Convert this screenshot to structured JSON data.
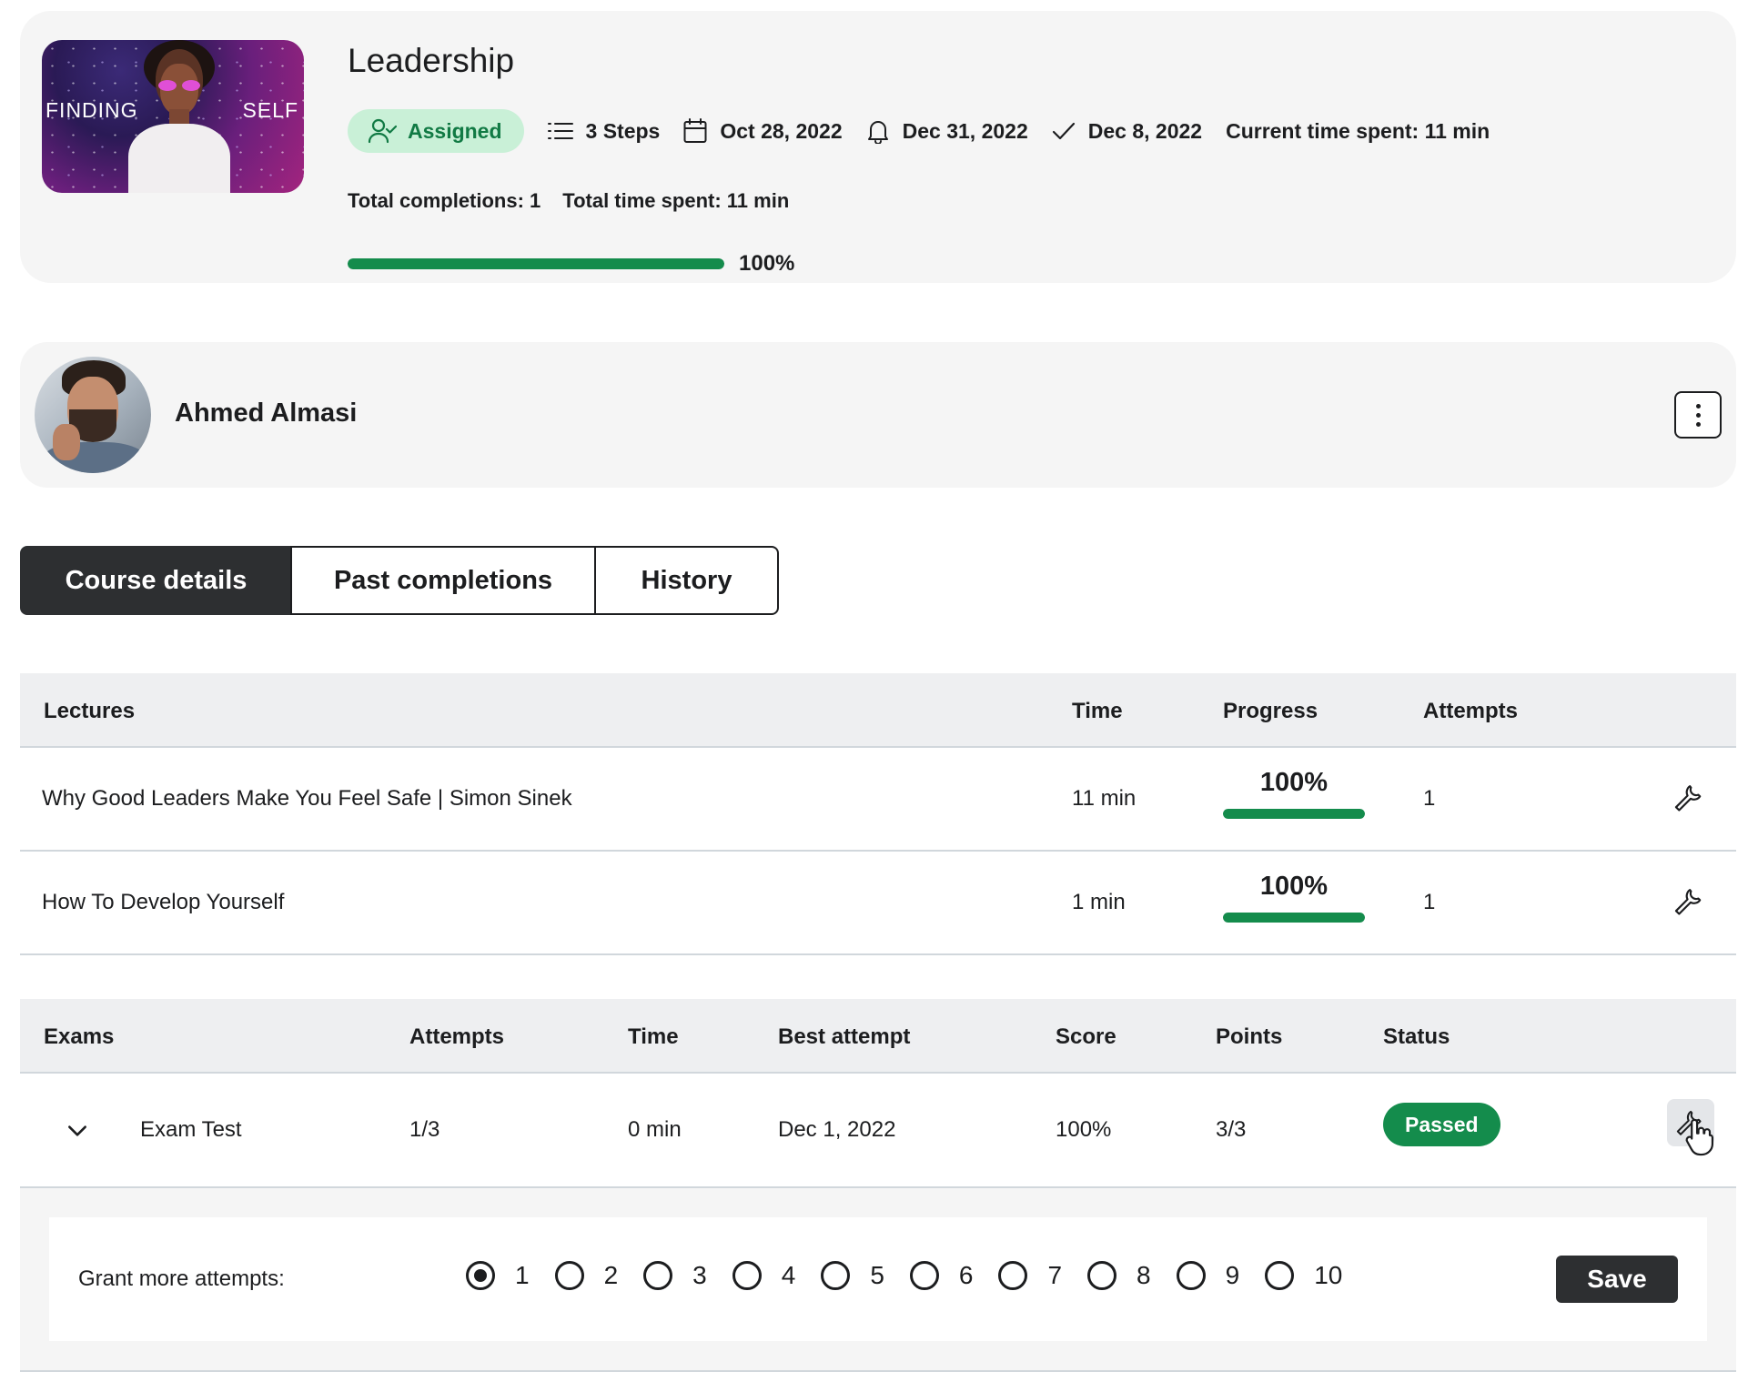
{
  "course": {
    "title": "Leadership",
    "thumbnail_left_text": "FINDING",
    "thumbnail_right_text": "SELF",
    "status_badge": "Assigned",
    "steps": "3 Steps",
    "start_date": "Oct 28, 2022",
    "due_date": "Dec 31, 2022",
    "completed_date": "Dec 8, 2022",
    "current_time_spent": "Current time spent: 11 min",
    "total_completions": "Total completions: 1",
    "total_time_spent": "Total time spent: 11 min",
    "progress_percent": 100,
    "progress_label": "100%",
    "icons": [
      "user-check-icon",
      "list-icon",
      "calendar-icon",
      "bell-icon",
      "check-icon"
    ]
  },
  "user": {
    "name": "Ahmed Almasi",
    "menu_icon": "kebab-menu-icon"
  },
  "tabs": [
    {
      "label": "Course details",
      "active": true
    },
    {
      "label": "Past completions",
      "active": false
    },
    {
      "label": "History",
      "active": false
    }
  ],
  "lectures": {
    "headers": {
      "title": "Lectures",
      "time": "Time",
      "progress": "Progress",
      "attempts": "Attempts"
    },
    "rows": [
      {
        "title": "Why Good Leaders Make You Feel Safe | Simon Sinek",
        "time": "11 min",
        "progress_label": "100%",
        "progress_percent": 100,
        "attempts": "1"
      },
      {
        "title": "How To Develop Yourself",
        "time": "1 min",
        "progress_label": "100%",
        "progress_percent": 100,
        "attempts": "1"
      }
    ]
  },
  "exams": {
    "headers": {
      "title": "Exams",
      "attempts": "Attempts",
      "time": "Time",
      "best_attempt": "Best attempt",
      "score": "Score",
      "points": "Points",
      "status": "Status"
    },
    "rows": [
      {
        "title": "Exam Test",
        "attempts": "1/3",
        "time": "0 min",
        "best_attempt": "Dec 1, 2022",
        "score": "100%",
        "points": "3/3",
        "status": "Passed"
      }
    ],
    "grant": {
      "label": "Grant more attempts:",
      "options": [
        "1",
        "2",
        "3",
        "4",
        "5",
        "6",
        "7",
        "8",
        "9",
        "10"
      ],
      "selected": "1",
      "save_label": "Save"
    }
  },
  "colors": {
    "accent_green": "#148c4c",
    "badge_bg": "#c9f0d7",
    "dark": "#2d2f31",
    "card_bg": "#f5f5f5"
  }
}
